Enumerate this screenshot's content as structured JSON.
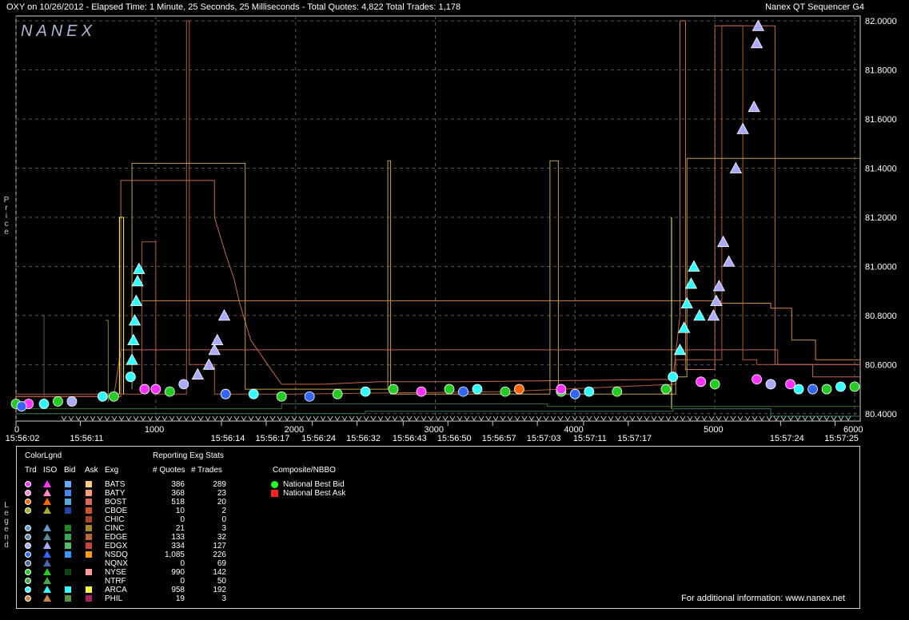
{
  "header": {
    "title": "OXY on 10/26/2012  -  Elapsed Time: 1 Minute, 25 Seconds, 25 Milliseconds  -  Total Quotes: 4,822  Total Trades: 1,178",
    "app_name": "Nanex QT Sequencer G4",
    "logo": "NANEX"
  },
  "side_labels": {
    "price": "Price",
    "legend": "Legend"
  },
  "chart_data": {
    "type": "scatter",
    "title": "OXY on 10/26/2012",
    "ylabel": "Price",
    "ylim": [
      80.37,
      82.02
    ],
    "xlim": [
      0,
      6040
    ],
    "y_ticks": [
      "80.4000",
      "80.6000",
      "80.8000",
      "81.0000",
      "81.2000",
      "81.4000",
      "81.6000",
      "81.8000",
      "82.0000"
    ],
    "y_tick_values": [
      80.4,
      80.6,
      80.8,
      81.0,
      81.2,
      81.4,
      81.6,
      81.8,
      82.0
    ],
    "x_ticks": [
      "0",
      "1000",
      "2000",
      "3000",
      "4000",
      "5000",
      "6000"
    ],
    "x_tick_values": [
      0,
      1000,
      2000,
      3000,
      4000,
      5000,
      6000
    ],
    "time_labels": [
      {
        "x": 0,
        "t": "15:56:02"
      },
      {
        "x": 460,
        "t": "15:56:11"
      },
      {
        "x": 1470,
        "t": "15:56:14"
      },
      {
        "x": 1790,
        "t": "15:56:17"
      },
      {
        "x": 2120,
        "t": "15:56:24"
      },
      {
        "x": 2440,
        "t": "15:56:32"
      },
      {
        "x": 2770,
        "t": "15:56:43"
      },
      {
        "x": 3090,
        "t": "15:56:50"
      },
      {
        "x": 3410,
        "t": "15:56:57"
      },
      {
        "x": 3730,
        "t": "15:57:03"
      },
      {
        "x": 4060,
        "t": "15:57:11"
      },
      {
        "x": 4380,
        "t": "15:57:17"
      },
      {
        "x": 5470,
        "t": "15:57:24"
      },
      {
        "x": 5860,
        "t": "15:57:25"
      }
    ],
    "grid": true,
    "series": [
      {
        "name": "NYSE",
        "color": "#22cc22",
        "points": [
          [
            0,
            80.44
          ],
          [
            300,
            80.45
          ],
          [
            700,
            80.47
          ],
          [
            1100,
            80.49
          ],
          [
            1500,
            80.48
          ],
          [
            1900,
            80.47
          ],
          [
            2300,
            80.48
          ],
          [
            2700,
            80.5
          ],
          [
            3100,
            80.5
          ],
          [
            3500,
            80.49
          ],
          [
            3900,
            80.49
          ],
          [
            4300,
            80.49
          ],
          [
            4650,
            80.5
          ],
          [
            5000,
            80.52
          ],
          [
            5400,
            80.52
          ],
          [
            5800,
            80.5
          ],
          [
            6000,
            80.51
          ]
        ]
      },
      {
        "name": "ARCA",
        "color": "#33ffff",
        "points": [
          [
            200,
            80.44
          ],
          [
            620,
            80.47
          ],
          [
            820,
            80.55
          ],
          [
            830,
            80.62
          ],
          [
            840,
            80.7
          ],
          [
            850,
            80.78
          ],
          [
            860,
            80.86
          ],
          [
            870,
            80.94
          ],
          [
            880,
            80.99
          ],
          [
            1700,
            80.48
          ],
          [
            2500,
            80.49
          ],
          [
            3300,
            80.5
          ],
          [
            4100,
            80.49
          ],
          [
            4700,
            80.55
          ],
          [
            4750,
            80.66
          ],
          [
            4780,
            80.75
          ],
          [
            4800,
            80.85
          ],
          [
            4830,
            80.93
          ],
          [
            4850,
            81.0
          ],
          [
            4890,
            80.8
          ],
          [
            5600,
            80.5
          ],
          [
            5900,
            80.51
          ]
        ]
      },
      {
        "name": "EDGX",
        "color": "#aaaaff",
        "points": [
          [
            400,
            80.45
          ],
          [
            1200,
            80.52
          ],
          [
            1300,
            80.56
          ],
          [
            1380,
            80.6
          ],
          [
            1420,
            80.66
          ],
          [
            1440,
            80.7
          ],
          [
            1490,
            80.8
          ],
          [
            4990,
            80.8
          ],
          [
            5010,
            80.86
          ],
          [
            5030,
            80.92
          ],
          [
            5060,
            81.1
          ],
          [
            5100,
            81.02
          ],
          [
            5150,
            81.4
          ],
          [
            5200,
            81.56
          ],
          [
            5280,
            81.65
          ],
          [
            5300,
            81.91
          ],
          [
            5310,
            81.98
          ],
          [
            5400,
            80.52
          ]
        ]
      },
      {
        "name": "BATS",
        "color": "#ff33ff",
        "points": [
          [
            90,
            80.44
          ],
          [
            920,
            80.5
          ],
          [
            1000,
            80.5
          ],
          [
            2900,
            80.49
          ],
          [
            3900,
            80.5
          ],
          [
            4900,
            80.53
          ],
          [
            5300,
            80.54
          ],
          [
            5540,
            80.52
          ]
        ]
      },
      {
        "name": "NSDQ",
        "color": "#3366ff",
        "points": [
          [
            40,
            80.43
          ],
          [
            1500,
            80.48
          ],
          [
            2100,
            80.47
          ],
          [
            3200,
            80.49
          ],
          [
            4000,
            80.48
          ],
          [
            5700,
            80.5
          ]
        ]
      },
      {
        "name": "BOST",
        "color": "#ff6600",
        "points": [
          [
            3600,
            80.5
          ]
        ]
      }
    ],
    "bbo_lines": [
      {
        "color": "#c8684a",
        "points": [
          [
            0,
            80.47
          ],
          [
            750,
            80.47
          ],
          [
            750,
            81.35
          ],
          [
            930,
            81.35
          ],
          [
            930,
            81.35
          ],
          [
            1420,
            81.35
          ],
          [
            1420,
            81.2
          ],
          [
            1500,
            81.05
          ],
          [
            1560,
            80.95
          ],
          [
            1600,
            80.85
          ],
          [
            1680,
            80.7
          ],
          [
            1800,
            80.6
          ],
          [
            1900,
            80.52
          ],
          [
            2200,
            80.52
          ],
          [
            2600,
            80.53
          ],
          [
            3200,
            80.53
          ],
          [
            3200,
            80.53
          ],
          [
            4700,
            80.54
          ],
          [
            4750,
            80.8
          ],
          [
            4750,
            82.0
          ],
          [
            4790,
            82.0
          ],
          [
            4790,
            80.58
          ],
          [
            5000,
            80.58
          ],
          [
            5000,
            81.98
          ],
          [
            5430,
            81.98
          ],
          [
            5430,
            80.6
          ],
          [
            5700,
            80.6
          ],
          [
            5700,
            80.55
          ],
          [
            6040,
            80.55
          ]
        ]
      },
      {
        "color": "#b45b3a",
        "points": [
          [
            0,
            80.48
          ],
          [
            900,
            80.48
          ],
          [
            900,
            81.1
          ],
          [
            1000,
            81.1
          ],
          [
            1000,
            80.48
          ],
          [
            1220,
            80.48
          ],
          [
            1220,
            82.0
          ],
          [
            1240,
            82.0
          ],
          [
            1240,
            80.6
          ],
          [
            1420,
            80.6
          ],
          [
            1420,
            80.48
          ],
          [
            2000,
            80.48
          ],
          [
            3500,
            80.49
          ],
          [
            4720,
            80.52
          ],
          [
            4720,
            80.62
          ],
          [
            5050,
            80.62
          ],
          [
            5050,
            81.98
          ],
          [
            5200,
            81.98
          ],
          [
            5200,
            80.62
          ],
          [
            5300,
            80.62
          ],
          [
            5300,
            80.6
          ],
          [
            6040,
            80.6
          ]
        ]
      },
      {
        "color": "#c2a14e",
        "points": [
          [
            830,
            80.5
          ],
          [
            830,
            81.42
          ],
          [
            1640,
            81.42
          ],
          [
            1640,
            80.5
          ],
          [
            2660,
            80.5
          ],
          [
            2660,
            81.43
          ],
          [
            2680,
            81.43
          ],
          [
            2680,
            80.48
          ],
          [
            3820,
            80.48
          ],
          [
            3820,
            81.43
          ],
          [
            3880,
            81.43
          ],
          [
            3880,
            80.48
          ],
          [
            4720,
            80.48
          ],
          [
            4720,
            80.55
          ],
          [
            4800,
            80.55
          ],
          [
            4800,
            81.44
          ],
          [
            6040,
            81.44
          ]
        ]
      },
      {
        "color": "#d28a3a",
        "points": [
          [
            900,
            80.86
          ],
          [
            5040,
            80.86
          ],
          [
            5040,
            80.85
          ],
          [
            5400,
            80.85
          ],
          [
            5400,
            80.83
          ],
          [
            5550,
            80.83
          ],
          [
            5550,
            80.7
          ],
          [
            5720,
            80.7
          ],
          [
            5720,
            80.62
          ],
          [
            6040,
            80.62
          ]
        ]
      },
      {
        "color": "#c06050",
        "points": [
          [
            0,
            80.47
          ],
          [
            60,
            80.47
          ],
          [
            60,
            80.47
          ],
          [
            400,
            80.47
          ],
          [
            400,
            80.47
          ],
          [
            700,
            80.47
          ],
          [
            750,
            80.66
          ],
          [
            4700,
            80.66
          ],
          [
            4700,
            80.66
          ],
          [
            5450,
            80.66
          ],
          [
            5450,
            80.6
          ],
          [
            6040,
            80.6
          ]
        ]
      },
      {
        "color": "#ffff33",
        "points": [
          [
            740,
            80.48
          ],
          [
            740,
            81.2
          ],
          [
            770,
            81.2
          ],
          [
            770,
            80.48
          ]
        ]
      },
      {
        "color": "#ffff33",
        "points": [
          [
            4690,
            80.42
          ],
          [
            4690,
            81.2
          ]
        ]
      },
      {
        "color": "#3a6b2a",
        "points": [
          [
            0,
            80.42
          ],
          [
            1900,
            80.42
          ],
          [
            1900,
            80.44
          ],
          [
            3800,
            80.44
          ],
          [
            3800,
            80.43
          ],
          [
            6040,
            80.43
          ]
        ]
      },
      {
        "color": "#2f7a5a",
        "points": [
          [
            0,
            80.4
          ],
          [
            2500,
            80.4
          ],
          [
            2500,
            80.41
          ],
          [
            4700,
            80.41
          ],
          [
            4700,
            80.42
          ],
          [
            5400,
            80.42
          ],
          [
            5400,
            80.39
          ],
          [
            6040,
            80.39
          ]
        ]
      },
      {
        "color": "#556b2f",
        "points": [
          [
            180,
            80.8
          ],
          [
            200,
            80.8
          ],
          [
            200,
            80.45
          ]
        ]
      },
      {
        "color": "#808020",
        "points": [
          [
            640,
            80.78
          ],
          [
            660,
            80.78
          ],
          [
            660,
            80.45
          ]
        ]
      }
    ]
  },
  "legend": {
    "color_legend_label": "ColorLgnd",
    "col_trd": "Trd",
    "col_iso": "ISO",
    "col_bid": "Bid",
    "col_ask": "Ask",
    "col_exg": "Exg",
    "stats_title": "Reporting Exg Stats",
    "col_quotes": "# Quotes",
    "col_trades": "# Trades",
    "composite_title": "Composite/NBBO",
    "rows": [
      {
        "exg": "BATS",
        "quotes": "386",
        "trades": "289",
        "trd": "#ff33ff",
        "iso": "#ff33ff",
        "bid": "#66aaff",
        "ask": "#ffcc88"
      },
      {
        "exg": "BATY",
        "quotes": "368",
        "trades": "23",
        "trd": "#ff88cc",
        "iso": "#ff88cc",
        "bid": "#4488ee",
        "ask": "#ff9977"
      },
      {
        "exg": "BOST",
        "quotes": "518",
        "trades": "20",
        "trd": "#ff6600",
        "iso": "#ff6600",
        "bid": "#55aadd",
        "ask": "#dd6655"
      },
      {
        "exg": "CBOE",
        "quotes": "10",
        "trades": "2",
        "trd": "#aaaa22",
        "iso": "#aaaa22",
        "bid": "#2244aa",
        "ask": "#cc5522"
      },
      {
        "exg": "CHIC",
        "quotes": "0",
        "trades": "0",
        "trd": "",
        "iso": "",
        "bid": "",
        "ask": "#aa4422"
      },
      {
        "exg": "CINC",
        "quotes": "21",
        "trades": "3",
        "trd": "#6699cc",
        "iso": "#6699cc",
        "bid": "#228822",
        "ask": "#aa8822"
      },
      {
        "exg": "EDGE",
        "quotes": "133",
        "trades": "32",
        "trd": "#558899",
        "iso": "#558899",
        "bid": "#33aa55",
        "ask": "#bb6633"
      },
      {
        "exg": "EDGX",
        "quotes": "334",
        "trades": "127",
        "trd": "#aaaaff",
        "iso": "#aaaaff",
        "bid": "#55bb66",
        "ask": "#cc4433"
      },
      {
        "exg": "NSDQ",
        "quotes": "1,085",
        "trades": "226",
        "trd": "#3366ff",
        "iso": "#3366ff",
        "bid": "#3399ff",
        "ask": "#ff9900"
      },
      {
        "exg": "NQNX",
        "quotes": "0",
        "trades": "69",
        "trd": "#4466aa",
        "iso": "#4466aa",
        "bid": "",
        "ask": ""
      },
      {
        "exg": "NYSE",
        "quotes": "990",
        "trades": "142",
        "trd": "#22cc22",
        "iso": "#22cc22",
        "bid": "#114411",
        "ask": "#ff9999"
      },
      {
        "exg": "NTRF",
        "quotes": "0",
        "trades": "50",
        "trd": "#44aa44",
        "iso": "#44aa44",
        "bid": "",
        "ask": ""
      },
      {
        "exg": "ARCA",
        "quotes": "958",
        "trades": "192",
        "trd": "#33ffff",
        "iso": "#33ffff",
        "bid": "#33ffff",
        "ask": "#ffff33"
      },
      {
        "exg": "PHIL",
        "quotes": "19",
        "trades": "3",
        "trd": "#cc8844",
        "iso": "#cc8844",
        "bid": "#559944",
        "ask": "#aa2266"
      }
    ],
    "nbbo": [
      {
        "label": "National Best Bid",
        "color": "#22ff22",
        "shape": "circle"
      },
      {
        "label": "National Best Ask",
        "color": "#ff2222",
        "shape": "square"
      }
    ],
    "footer": "For additional information: www.nanex.net"
  }
}
